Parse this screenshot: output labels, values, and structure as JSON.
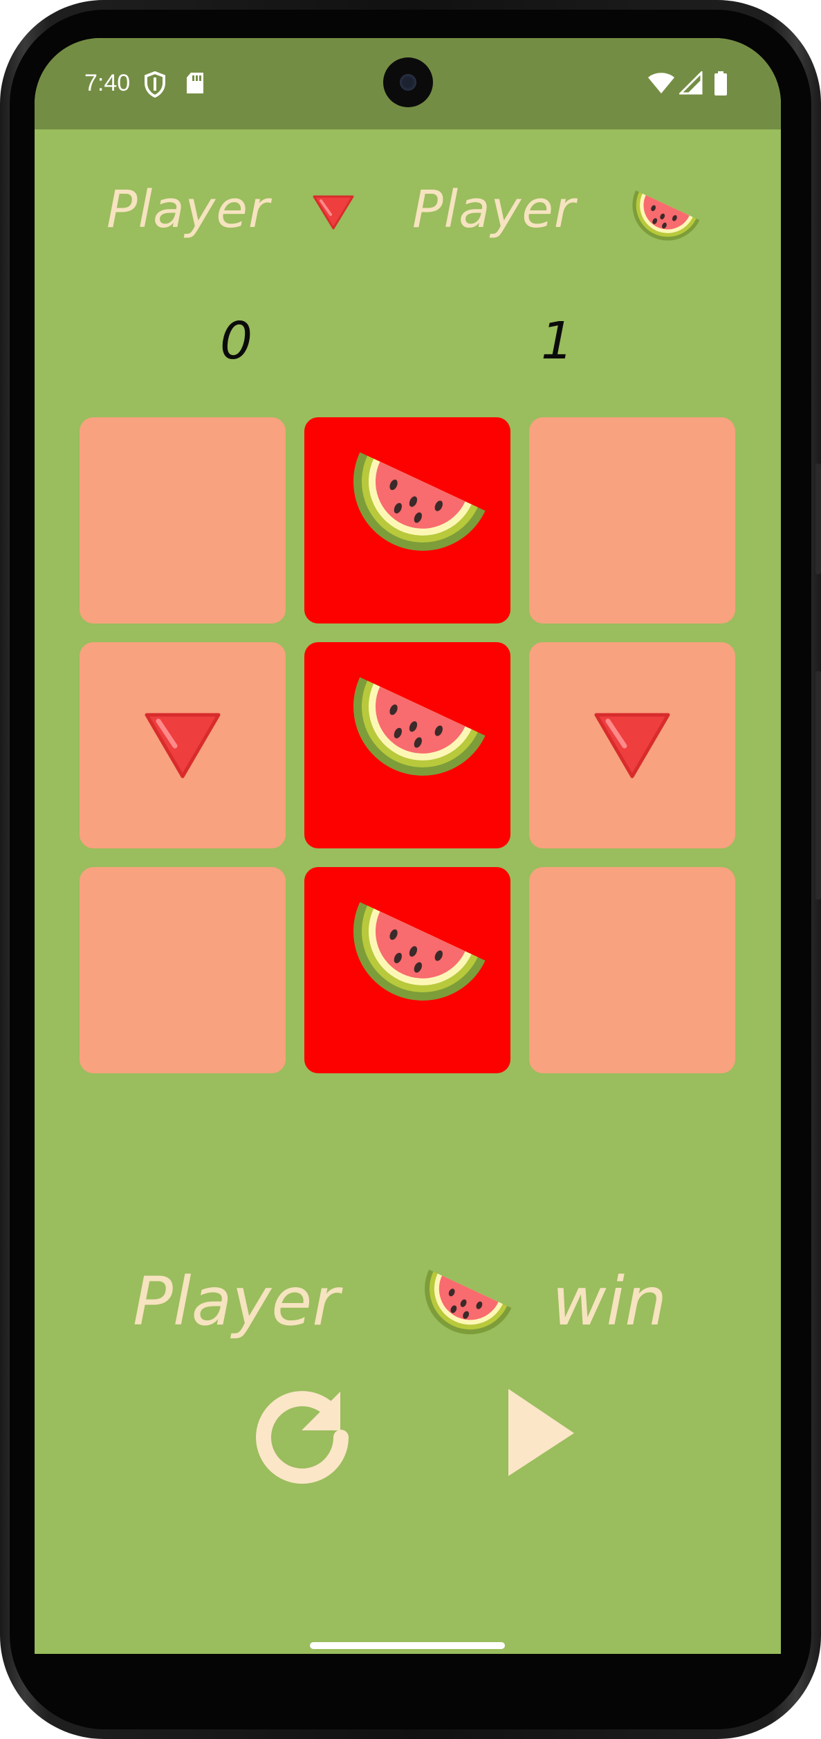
{
  "status_bar": {
    "time": "7:40",
    "left_icons": [
      "shield-icon",
      "sd-card-icon"
    ],
    "right_icons": [
      "wifi-icon",
      "signal-icon",
      "battery-icon"
    ]
  },
  "players": [
    {
      "label": "Player",
      "piece": "triangle",
      "score": "0"
    },
    {
      "label": "Player",
      "piece": "watermelon",
      "score": "1"
    }
  ],
  "board": {
    "cells": [
      {
        "piece": "",
        "winning": false
      },
      {
        "piece": "watermelon",
        "winning": true
      },
      {
        "piece": "",
        "winning": false
      },
      {
        "piece": "triangle",
        "winning": false
      },
      {
        "piece": "watermelon",
        "winning": true
      },
      {
        "piece": "triangle",
        "winning": false
      },
      {
        "piece": "",
        "winning": false
      },
      {
        "piece": "watermelon",
        "winning": true
      },
      {
        "piece": "",
        "winning": false
      }
    ]
  },
  "result": {
    "prefix": "Player",
    "winner_piece": "watermelon",
    "suffix": "win"
  },
  "controls": {
    "restart_icon": "restart-icon",
    "play_icon": "play-icon"
  },
  "colors": {
    "background": "#9abd5d",
    "status_bar": "#748d44",
    "cell": "#f8a27f",
    "winning_cell": "#fd0000",
    "text_cream": "#f6e3c0",
    "score_text": "#0b0b0b"
  }
}
